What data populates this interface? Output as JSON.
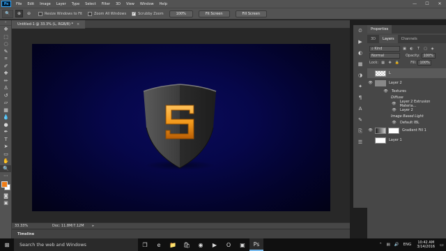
{
  "app": {
    "logo": "Ps"
  },
  "menu": [
    "File",
    "Edit",
    "Image",
    "Layer",
    "Type",
    "Select",
    "Filter",
    "3D",
    "View",
    "Window",
    "Help"
  ],
  "window_controls": {
    "minimize": "—",
    "maximize": "☐",
    "close": "✕"
  },
  "options": {
    "resize_windows": "Resize Windows to Fit",
    "zoom_all": "Zoom All Windows",
    "scrubby_zoom": "Scrubby Zoom",
    "btn_100": "100%",
    "fit_screen": "Fit Screen",
    "fill_screen": "Fill Screen"
  },
  "doc_tab": {
    "title": "Untitled-1 @ 33.3% (L, RGB/8) *",
    "close": "×"
  },
  "status": {
    "zoom": "33.33%",
    "doc": "Doc: 11.8M/7.12M",
    "arrow": "▸"
  },
  "timeline": {
    "label": "Timeline"
  },
  "panels": {
    "properties_tab": "Properties",
    "tabs": [
      "3D",
      "Layers",
      "Channels"
    ],
    "kind_label": "Kind",
    "blend_mode": "Normal",
    "opacity_label": "Opacity:",
    "opacity_value": "100%",
    "lock_label": "Lock:",
    "fill_label": "Fill:",
    "fill_value": "100%",
    "layers": [
      {
        "name": "L"
      },
      {
        "name": "Layer 2"
      },
      {
        "name": "Textures"
      },
      {
        "name": "Diffuse"
      },
      {
        "name": "Layer 2 Extrusion Materia..."
      },
      {
        "name": "Layer 2"
      },
      {
        "name": "Image Based Light"
      },
      {
        "name": "Default IBL"
      },
      {
        "name": "Gradient Fill 1"
      },
      {
        "name": "Layer 1"
      }
    ]
  },
  "taskbar": {
    "search_placeholder": "Search the web and Windows",
    "lang": "ENG",
    "time": "10:42 AM",
    "date": "3/14/2016"
  },
  "colors": {
    "foreground": "#f07c16",
    "background": "#ffffff",
    "canvas": "#06074a",
    "accent": "#31a8ff"
  }
}
